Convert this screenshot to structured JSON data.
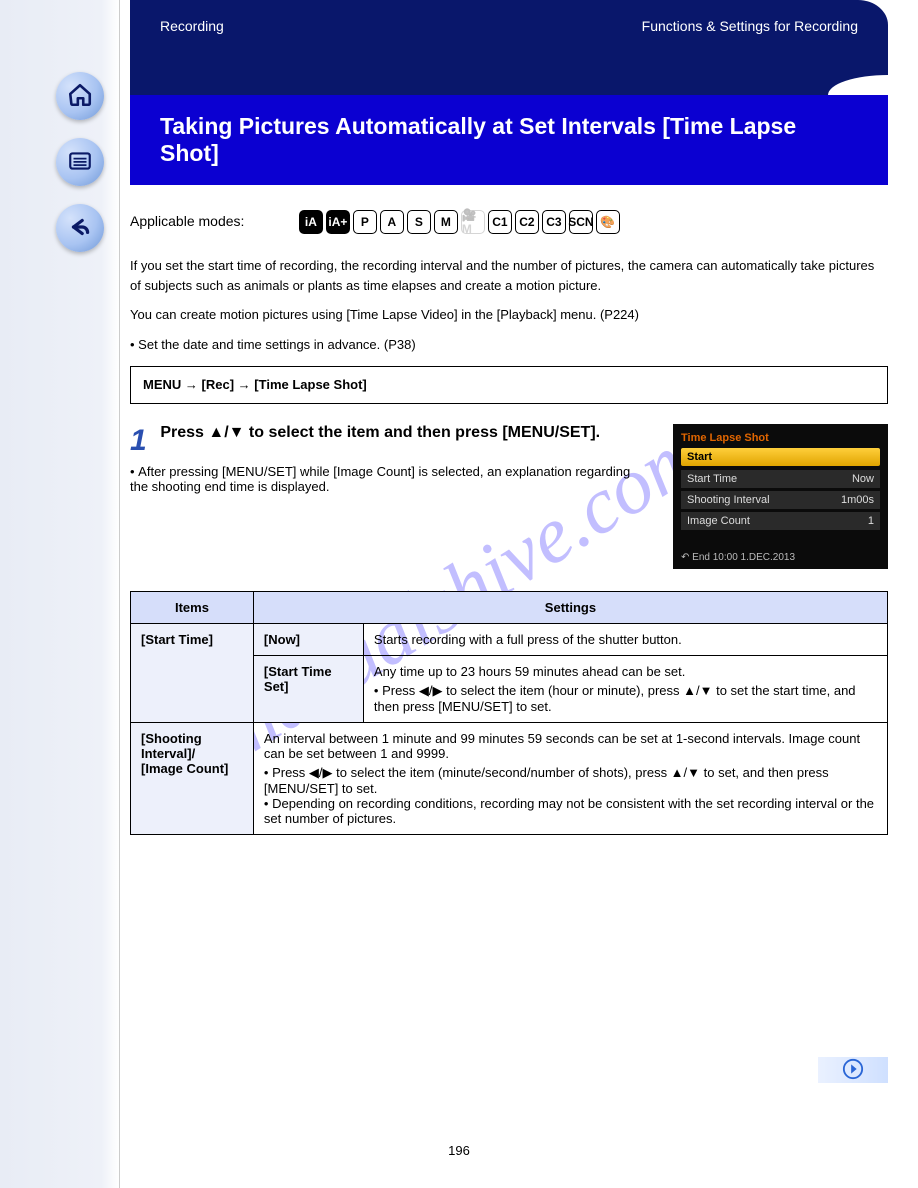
{
  "nav": {
    "home_icon": "home-icon",
    "list_icon": "list-icon",
    "back_icon": "back-icon"
  },
  "header": {
    "section": "Recording",
    "sub": "Functions & Settings for Recording",
    "title": "Taking Pictures Automatically at Set Intervals [Time Lapse Shot]"
  },
  "modes": {
    "label": "Applicable modes:",
    "icons": [
      {
        "text": "iA",
        "style": "filled",
        "name": "mode-ia"
      },
      {
        "text": "iA+",
        "style": "filled",
        "name": "mode-ia-plus"
      },
      {
        "text": "P",
        "style": "",
        "name": "mode-p"
      },
      {
        "text": "A",
        "style": "",
        "name": "mode-a"
      },
      {
        "text": "S",
        "style": "",
        "name": "mode-s"
      },
      {
        "text": "M",
        "style": "",
        "name": "mode-m"
      },
      {
        "text": "🎥M",
        "style": "dim",
        "name": "mode-movie-m"
      },
      {
        "text": "C1",
        "style": "",
        "name": "mode-c1"
      },
      {
        "text": "C2",
        "style": "",
        "name": "mode-c2"
      },
      {
        "text": "C3",
        "style": "",
        "name": "mode-c3"
      },
      {
        "text": "SCN",
        "style": "",
        "name": "mode-scn"
      },
      {
        "text": "🎨",
        "style": "",
        "name": "mode-creative"
      }
    ]
  },
  "intro": {
    "p1": "If you set the start time of recording, the recording interval and the number of pictures, the camera can automatically take pictures of subjects such as animals or plants as time elapses and create a motion picture.",
    "p2": "You can create motion pictures using [Time Lapse Video] in the [Playback] menu. (P224)",
    "bullet": "Set the date and time settings in advance. (P38)"
  },
  "menu_path": {
    "root": "MENU",
    "step1": "[Rec]",
    "step2": "[Time Lapse Shot]"
  },
  "step1": {
    "num": "1",
    "title": "Press ▲/▼ to select the item and then press [MENU/SET].",
    "bullet": "After pressing [MENU/SET] while [Image Count] is selected, an explanation regarding the shooting end time is displayed."
  },
  "lcd": {
    "title": "Time Lapse Shot",
    "selected": "Start",
    "rows": [
      {
        "l": "Start Time",
        "r": "Now"
      },
      {
        "l": "Shooting Interval",
        "r": "1m00s"
      },
      {
        "l": "Image Count",
        "r": "1"
      }
    ],
    "footer": "End  10:00  1.DEC.2013"
  },
  "table": {
    "head": [
      "Items",
      "Settings"
    ],
    "rows": [
      {
        "label": "[Start Time]",
        "sub": [
          {
            "k": "[Now]",
            "v": "Starts recording with a full press of the shutter button."
          },
          {
            "k": "[Start Time Set]",
            "v": "Any time up to 23 hours 59 minutes ahead can be set.",
            "bullets": [
              "Press ◀/▶ to select the item (hour or minute), press ▲/▼ to set the start time, and then press [MENU/SET] to set."
            ]
          }
        ]
      },
      {
        "label": "[Shooting Interval]/\n[Image Count]",
        "body": "An interval between 1 minute and 99 minutes 59 seconds can be set at 1-second intervals. Image count can be set between 1 and 9999.",
        "bullets": [
          "Press ◀/▶ to select the item (minute/second/number of shots), press ▲/▼ to set, and then press [MENU/SET] to set.",
          "Depending on recording conditions, recording may not be consistent with the set recording interval or the set number of pictures."
        ]
      }
    ]
  },
  "watermark": "manualshive.com",
  "page_number": "196"
}
